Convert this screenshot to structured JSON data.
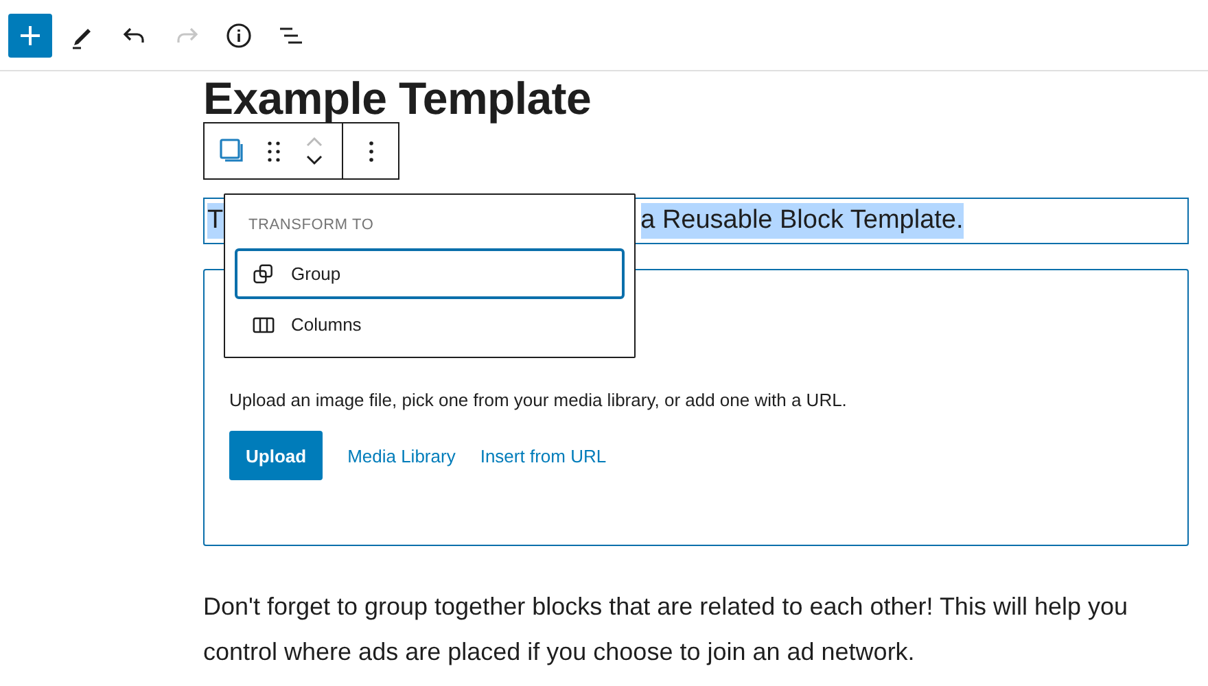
{
  "top_toolbar": [
    {
      "kind": "add",
      "disabled": false
    },
    {
      "kind": "edit",
      "disabled": false
    },
    {
      "kind": "undo",
      "disabled": false
    },
    {
      "kind": "redo",
      "disabled": true
    },
    {
      "kind": "info",
      "disabled": false
    },
    {
      "kind": "outline",
      "disabled": false
    }
  ],
  "heading": "Example Template",
  "block_toolbar": [
    {
      "kind": "transform"
    },
    {
      "kind": "drag"
    },
    {
      "kind": "move"
    },
    {
      "kind": "more"
    }
  ],
  "transform_menu": {
    "title": "TRANSFORM TO",
    "items": [
      {
        "label": "Group",
        "kind": "group",
        "selected": true
      },
      {
        "label": "Columns",
        "kind": "columns",
        "selected": false
      }
    ]
  },
  "selected_paragraph": {
    "start": "T",
    "end": "a Reusable Block Template.",
    "highlighted": true
  },
  "image_block": {
    "instructions": "Upload an image file, pick one from your media library, or add one with a URL.",
    "buttons": [
      {
        "label": "Upload",
        "kind": "primary"
      },
      {
        "label": "Media Library",
        "kind": "link"
      },
      {
        "label": "Insert from URL",
        "kind": "link"
      }
    ]
  },
  "paragraph": "Don't forget to group together blocks that are related to each other! This will help you control where ads are placed if you choose to join an ad network."
}
